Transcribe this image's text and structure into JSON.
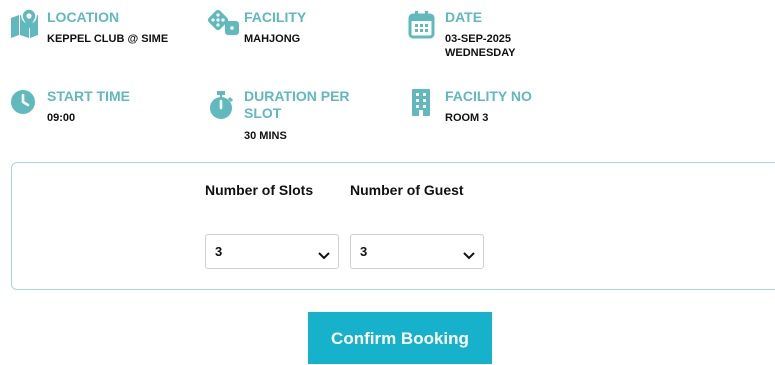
{
  "colors": {
    "accent": "#5fb9bd",
    "button": "#16b1cb",
    "panel_border": "#a9d8da"
  },
  "info": {
    "location": {
      "icon": "map-icon",
      "label": "LOCATION",
      "value": "KEPPEL CLUB @ SIME"
    },
    "facility": {
      "icon": "dice-icon",
      "label": "FACILITY",
      "value": "MAHJONG"
    },
    "date": {
      "icon": "calendar-icon",
      "label": "DATE",
      "value": "03-SEP-2025",
      "weekday": "WEDNESDAY"
    },
    "start_time": {
      "icon": "clock-icon",
      "label": "START TIME",
      "value": "09:00"
    },
    "duration": {
      "icon": "stopwatch-icon",
      "label_line1": "DURATION PER",
      "label_line2": "SLOT",
      "value": "30 MINS"
    },
    "facility_no": {
      "icon": "building-icon",
      "label": "FACILITY NO",
      "value": "ROOM 3"
    }
  },
  "form": {
    "slots": {
      "label": "Number of Slots",
      "selected": "3"
    },
    "guests": {
      "label": "Number of Guest",
      "selected": "3"
    }
  },
  "actions": {
    "confirm_label": "Confirm Booking"
  }
}
